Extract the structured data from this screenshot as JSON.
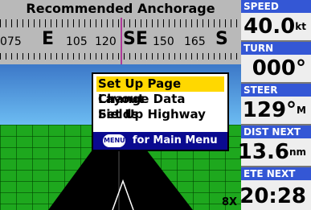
{
  "title": "Recommended Anchorage",
  "compass": {
    "labels": [
      "075",
      "E",
      "105",
      "120",
      "SE",
      "150",
      "165",
      "S"
    ]
  },
  "menu": {
    "items": [
      {
        "label": "Set Up Page Layout",
        "selected": true
      },
      {
        "label": "Change Data Fields",
        "selected": false
      },
      {
        "label": "Set Up Highway",
        "selected": false
      }
    ],
    "footer_icon": "MENU",
    "footer_text": "for Main Menu"
  },
  "zoom": "8X",
  "fields": [
    {
      "label": "SPEED",
      "value": "40.0",
      "unit": "kt"
    },
    {
      "label": "TURN",
      "value": "000°",
      "unit": ""
    },
    {
      "label": "STEER",
      "value": "129°",
      "unit": "M"
    },
    {
      "label": "DIST NEXT",
      "value": "13.6",
      "unit": "nm"
    },
    {
      "label": "ETE NEXT",
      "value": "20:28",
      "unit": ""
    }
  ],
  "colors": {
    "menu_selected": "#ffd800",
    "menu_footer": "#0a0a90",
    "field_label": "#3457d5",
    "ground": "#1ea81e",
    "heading_line": "#b03a9a"
  }
}
